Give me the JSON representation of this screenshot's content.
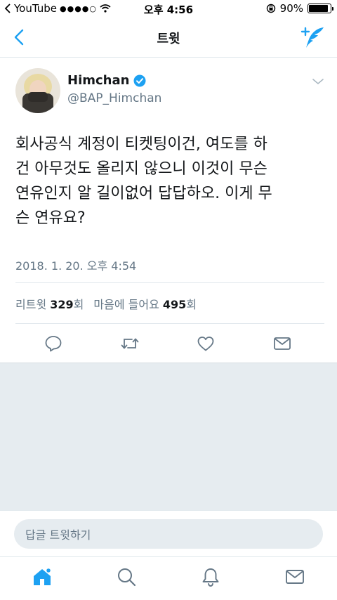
{
  "status_bar": {
    "app_back_label": "YouTube",
    "signal_dots": "●●●●○",
    "time": "오후 4:56",
    "battery_percent": "90%",
    "battery_level": 0.9
  },
  "nav": {
    "title": "트윗"
  },
  "tweet": {
    "display_name": "Himchan",
    "handle": "@BAP_Himchan",
    "text": "회사공식 계정이 티켓팅이건, 여도를 하\n건 아무것도 올리지 않으니 이것이 무슨\n연유인지 알 길이없어 답답하오. 이게 무\n슨 연유요?",
    "timestamp": "2018. 1. 20. 오후 4:54",
    "retweets_label": "리트윗",
    "retweets_count": "329",
    "retweets_unit": "회",
    "likes_label": "마음에 들어요",
    "likes_count": "495",
    "likes_unit": "회"
  },
  "reply": {
    "placeholder": "답글 트윗하기"
  },
  "colors": {
    "accent": "#1da1f2",
    "muted": "#657786",
    "tab_active": "#1da1f2"
  },
  "icons": {
    "back": "chevron-left-icon",
    "compose": "compose-tweet-icon",
    "verified": "verified-badge-icon",
    "reply": "reply-icon",
    "retweet": "retweet-icon",
    "like": "heart-icon",
    "dm": "envelope-icon",
    "home": "home-icon",
    "search": "search-icon",
    "notifications": "bell-icon",
    "messages": "mail-icon"
  }
}
